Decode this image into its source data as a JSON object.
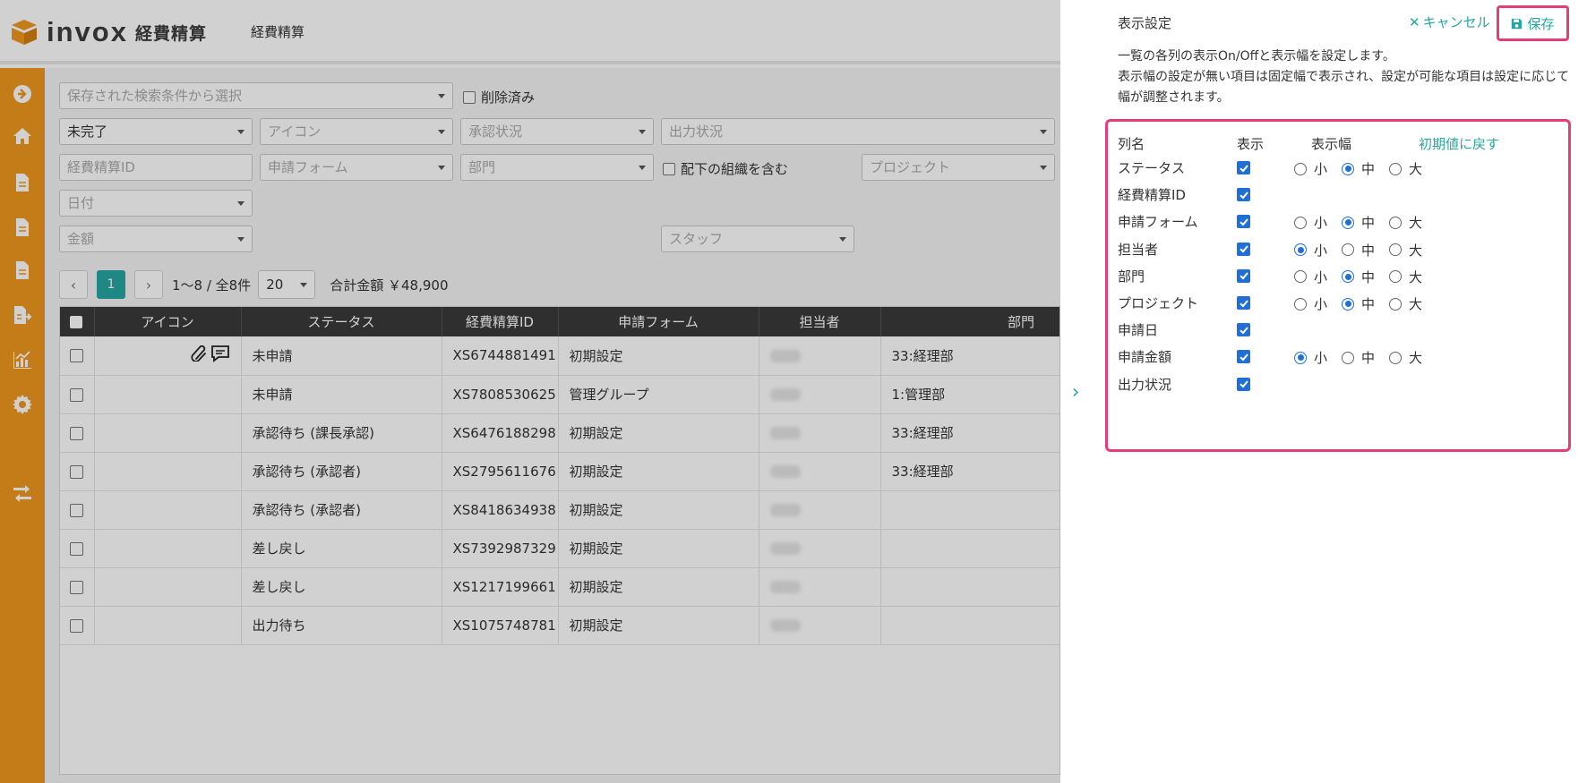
{
  "header": {
    "brand": "invox",
    "product": "経費精算",
    "title": "経費精算"
  },
  "sidebar": {
    "items": [
      "arrow-circle-icon",
      "home-icon",
      "document-icon",
      "document-icon",
      "document-icon",
      "file-export-icon",
      "chart-icon",
      "gear-icon",
      "transfer-icon"
    ]
  },
  "filters": {
    "saved_search_placeholder": "保存された検索条件から選択",
    "deleted_label": "削除済み",
    "status_value": "未完了",
    "icon_placeholder": "アイコン",
    "approval_placeholder": "承認状況",
    "output_placeholder": "出力状況",
    "expense_id_placeholder": "経費精算ID",
    "form_placeholder": "申請フォーム",
    "department_placeholder": "部門",
    "include_sub_label": "配下の組織を含む",
    "project_placeholder": "プロジェクト",
    "date_placeholder": "日付",
    "amount_placeholder": "金額",
    "staff_placeholder": "スタッフ"
  },
  "pager": {
    "current_page": "1",
    "range": "1〜8 / 全8件",
    "page_size": "20",
    "total_label": "合計金額 ￥48,900"
  },
  "table": {
    "columns": [
      "アイコン",
      "ステータス",
      "経費精算ID",
      "申請フォーム",
      "担当者",
      "部門"
    ],
    "rows": [
      {
        "status": "未申請",
        "id": "XS6744881491",
        "form": "初期設定",
        "dept": "33:経理部",
        "has_icons": true
      },
      {
        "status": "未申請",
        "id": "XS7808530625",
        "form": "管理グループ",
        "dept": "1:管理部",
        "has_icons": false
      },
      {
        "status": "承認待ち (課長承認)",
        "id": "XS6476188298",
        "form": "初期設定",
        "dept": "33:経理部",
        "has_icons": false
      },
      {
        "status": "承認待ち (承認者)",
        "id": "XS2795611676",
        "form": "初期設定",
        "dept": "33:経理部",
        "has_icons": false
      },
      {
        "status": "承認待ち (承認者)",
        "id": "XS8418634938",
        "form": "初期設定",
        "dept": "",
        "has_icons": false
      },
      {
        "status": "差し戻し",
        "id": "XS7392987329",
        "form": "初期設定",
        "dept": "",
        "has_icons": false
      },
      {
        "status": "差し戻し",
        "id": "XS1217199661",
        "form": "初期設定",
        "dept": "",
        "has_icons": false
      },
      {
        "status": "出力待ち",
        "id": "XS1075748781",
        "form": "初期設定",
        "dept": "",
        "has_icons": false
      }
    ]
  },
  "panel": {
    "title": "表示設定",
    "cancel_label": "キャンセル",
    "save_label": "保存",
    "description_line1": "一覧の各列の表示On/Offと表示幅を設定します。",
    "description_line2": "表示幅の設定が無い項目は固定幅で表示され、設定が可能な項目は設定に応じて幅が調整されます。",
    "headers": {
      "name": "列名",
      "visible": "表示",
      "width": "表示幅",
      "reset": "初期値に戻す"
    },
    "width_options": [
      "小",
      "中",
      "大"
    ],
    "columns": [
      {
        "name": "ステータス",
        "visible": true,
        "width": "中"
      },
      {
        "name": "経費精算ID",
        "visible": true,
        "width": null
      },
      {
        "name": "申請フォーム",
        "visible": true,
        "width": "中"
      },
      {
        "name": "担当者",
        "visible": true,
        "width": "小"
      },
      {
        "name": "部門",
        "visible": true,
        "width": "中"
      },
      {
        "name": "プロジェクト",
        "visible": true,
        "width": "中"
      },
      {
        "name": "申請日",
        "visible": true,
        "width": null
      },
      {
        "name": "申請金額",
        "visible": true,
        "width": "小"
      },
      {
        "name": "出力状況",
        "visible": true,
        "width": null
      }
    ]
  },
  "colors": {
    "sidebar": "#f0981f",
    "accent": "#27a6a1",
    "highlight": "#e63e74",
    "checkbox": "#1f6fd6"
  }
}
